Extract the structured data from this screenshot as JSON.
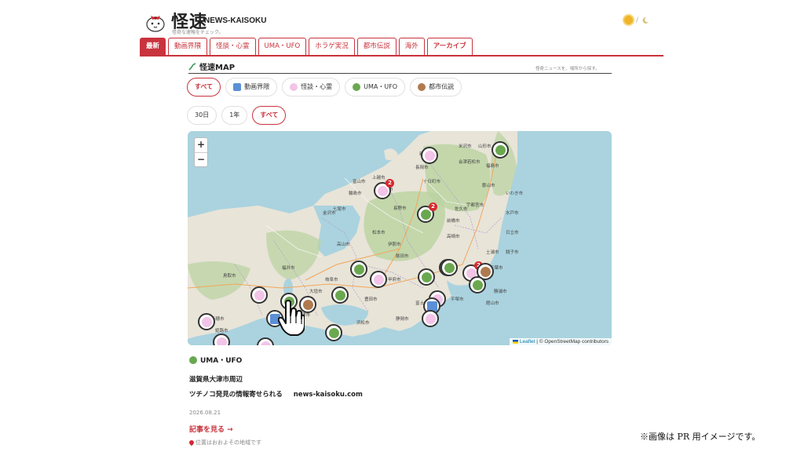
{
  "header": {
    "site_name": "怪速",
    "site_name_en": "NEWS-KAISOKU",
    "tagline": "怪奇な速報をチェック。",
    "theme_separator": "/"
  },
  "nav": {
    "tabs": [
      {
        "label": "最新",
        "active": true
      },
      {
        "label": "動画界隈",
        "active": false
      },
      {
        "label": "怪談・心霊",
        "active": false
      },
      {
        "label": "UMA・UFO",
        "active": false
      },
      {
        "label": "ホラゲ実況",
        "active": false
      },
      {
        "label": "都市伝説",
        "active": false
      },
      {
        "label": "海外",
        "active": false
      },
      {
        "label": "アーカイブ",
        "active": false
      }
    ]
  },
  "map_section": {
    "title": "怪速MAP",
    "note": "怪奇ニュースを、場所から探す。",
    "category_filters": [
      {
        "label": "すべて",
        "active": true,
        "icon": ""
      },
      {
        "label": "動画界隈",
        "active": false,
        "icon": "video-icon"
      },
      {
        "label": "怪談・心霊",
        "active": false,
        "icon": "ghost-icon"
      },
      {
        "label": "UMA・UFO",
        "active": false,
        "icon": "alien-icon"
      },
      {
        "label": "都市伝説",
        "active": false,
        "icon": "legend-icon"
      }
    ],
    "time_filters": [
      {
        "label": "30日",
        "active": false
      },
      {
        "label": "1年",
        "active": false
      },
      {
        "label": "すべて",
        "active": true
      }
    ],
    "zoom_in": "+",
    "zoom_out": "−",
    "attribution_leaflet": "Leaflet",
    "attribution_rest": " | © OpenStreetMap contributors",
    "cluster_badges": [
      "2",
      "2",
      "2"
    ],
    "city_labels": [
      "長野市",
      "金沢市",
      "富山市",
      "新潟市",
      "豊田市",
      "浜松市",
      "静岡市",
      "甲府市",
      "松本市",
      "高崎市",
      "宇都宮市",
      "福井市",
      "岐阜市",
      "大垣市",
      "津市",
      "奈良市",
      "赤穂市",
      "姫路市",
      "鳥取市",
      "富士市",
      "平塚市",
      "千葉市",
      "銚子市",
      "水戸市",
      "いわき市",
      "郡山市",
      "福島市",
      "会津若松市",
      "米沢市",
      "山形市",
      "上越市",
      "十日町市",
      "長岡市",
      "柏崎市",
      "輪島市",
      "七尾市",
      "高山市",
      "飯田市",
      "伊那市",
      "佐久市",
      "前橋市",
      "日立市",
      "土浦市",
      "館山市",
      "勝浦市"
    ]
  },
  "detail": {
    "category": "UMA・UFO",
    "location": "滋賀県大津市周辺",
    "title": "ツチノコ発見の情報寄せられる",
    "source": "news-kaisoku.com",
    "date": "2026.08.21",
    "read_more": "記事を見る →",
    "location_note": "位置はおおよその地域です"
  },
  "pr_note": "※画像は PR 用イメージです。",
  "colors": {
    "accent": "#c9333d",
    "sea": "#aad3df",
    "land": "#e8e4d8",
    "forest": "#b9d3a0"
  }
}
